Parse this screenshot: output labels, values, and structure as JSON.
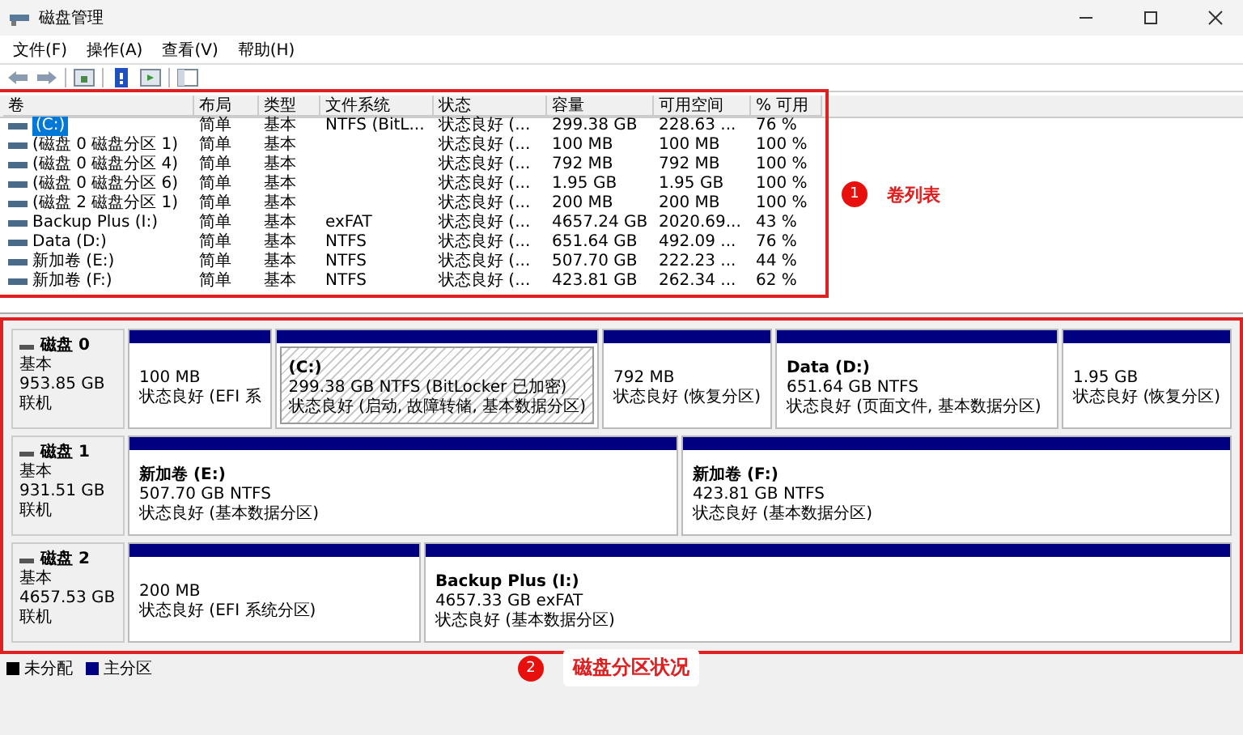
{
  "window": {
    "title": "磁盘管理"
  },
  "menu": [
    "文件(F)",
    "操作(A)",
    "查看(V)",
    "帮助(H)"
  ],
  "volume_table": {
    "columns": [
      "卷",
      "布局",
      "类型",
      "文件系统",
      "状态",
      "容量",
      "可用空间",
      "% 可用"
    ],
    "rows": [
      {
        "selected": true,
        "volume": "(C:)",
        "layout": "简单",
        "type": "基本",
        "file_system": "NTFS (BitL...",
        "status": "状态良好 (...",
        "capacity": "299.38 GB",
        "free": "228.63 ...",
        "percent": "76 %"
      },
      {
        "selected": false,
        "volume": "(磁盘 0 磁盘分区 1)",
        "layout": "简单",
        "type": "基本",
        "status": "状态良好 (...",
        "capacity": "100 MB",
        "free": "100 MB",
        "percent": "100 %"
      },
      {
        "selected": false,
        "volume": "(磁盘 0 磁盘分区 4)",
        "layout": "简单",
        "type": "基本",
        "status": "状态良好 (...",
        "capacity": "792 MB",
        "free": "792 MB",
        "percent": "100 %"
      },
      {
        "selected": false,
        "volume": "(磁盘 0 磁盘分区 6)",
        "layout": "简单",
        "type": "基本",
        "status": "状态良好 (...",
        "capacity": "1.95 GB",
        "free": "1.95 GB",
        "percent": "100 %"
      },
      {
        "selected": false,
        "volume": "(磁盘 2 磁盘分区 1)",
        "layout": "简单",
        "type": "基本",
        "status": "状态良好 (...",
        "capacity": "200 MB",
        "free": "200 MB",
        "percent": "100 %"
      },
      {
        "selected": false,
        "volume": "Backup Plus (I:)",
        "layout": "简单",
        "type": "基本",
        "file_system": "exFAT",
        "status": "状态良好 (...",
        "capacity": "4657.24 GB",
        "free": "2020.69...",
        "percent": "43 %"
      },
      {
        "selected": false,
        "volume": "Data (D:)",
        "layout": "简单",
        "type": "基本",
        "file_system": "NTFS",
        "status": "状态良好 (...",
        "capacity": "651.64 GB",
        "free": "492.09 ...",
        "percent": "76 %"
      },
      {
        "selected": false,
        "volume": "新加卷 (E:)",
        "layout": "简单",
        "type": "基本",
        "file_system": "NTFS",
        "status": "状态良好 (...",
        "capacity": "507.70 GB",
        "free": "222.23 ...",
        "percent": "44 %"
      },
      {
        "selected": false,
        "volume": "新加卷 (F:)",
        "layout": "简单",
        "type": "基本",
        "file_system": "NTFS",
        "status": "状态良好 (...",
        "capacity": "423.81 GB",
        "free": "262.34 ...",
        "percent": "62 %"
      }
    ]
  },
  "disks": [
    {
      "name": "磁盘 0",
      "type": "基本",
      "size": "953.85 GB",
      "status": "联机",
      "partitions": [
        {
          "selected": false,
          "size": "100 MB",
          "status": "状态良好 (EFI 系"
        },
        {
          "selected": true,
          "name": "(C:)",
          "size": "299.38 GB NTFS (BitLocker 已加密)",
          "status": "状态良好 (启动, 故障转储, 基本数据分区)"
        },
        {
          "selected": false,
          "size": "792 MB",
          "status": "状态良好 (恢复分区)"
        },
        {
          "selected": false,
          "name": "Data (D:)",
          "size": "651.64 GB NTFS",
          "status": "状态良好 (页面文件, 基本数据分区)"
        },
        {
          "selected": false,
          "size": "1.95 GB",
          "status": "状态良好 (恢复分区)"
        }
      ]
    },
    {
      "name": "磁盘 1",
      "type": "基本",
      "size": "931.51 GB",
      "status": "联机",
      "partitions": [
        {
          "selected": false,
          "name": "新加卷 (E:)",
          "size": "507.70 GB NTFS",
          "status": "状态良好 (基本数据分区)"
        },
        {
          "selected": false,
          "name": "新加卷 (F:)",
          "size": "423.81 GB NTFS",
          "status": "状态良好 (基本数据分区)"
        }
      ]
    },
    {
      "name": "磁盘 2",
      "type": "基本",
      "size": "4657.53 GB",
      "status": "联机",
      "partitions": [
        {
          "selected": false,
          "size": "200 MB",
          "status": "状态良好 (EFI 系统分区)"
        },
        {
          "selected": false,
          "name": "Backup Plus (I:)",
          "size": "4657.33 GB exFAT",
          "status": "状态良好 (基本数据分区)"
        }
      ]
    }
  ],
  "legend": [
    {
      "label": "未分配",
      "color": "#000000"
    },
    {
      "label": "主分区",
      "color": "#000080"
    }
  ],
  "annotations": [
    {
      "number": "1",
      "label": "卷列表"
    },
    {
      "number": "2",
      "label": "磁盘分区状况"
    }
  ]
}
